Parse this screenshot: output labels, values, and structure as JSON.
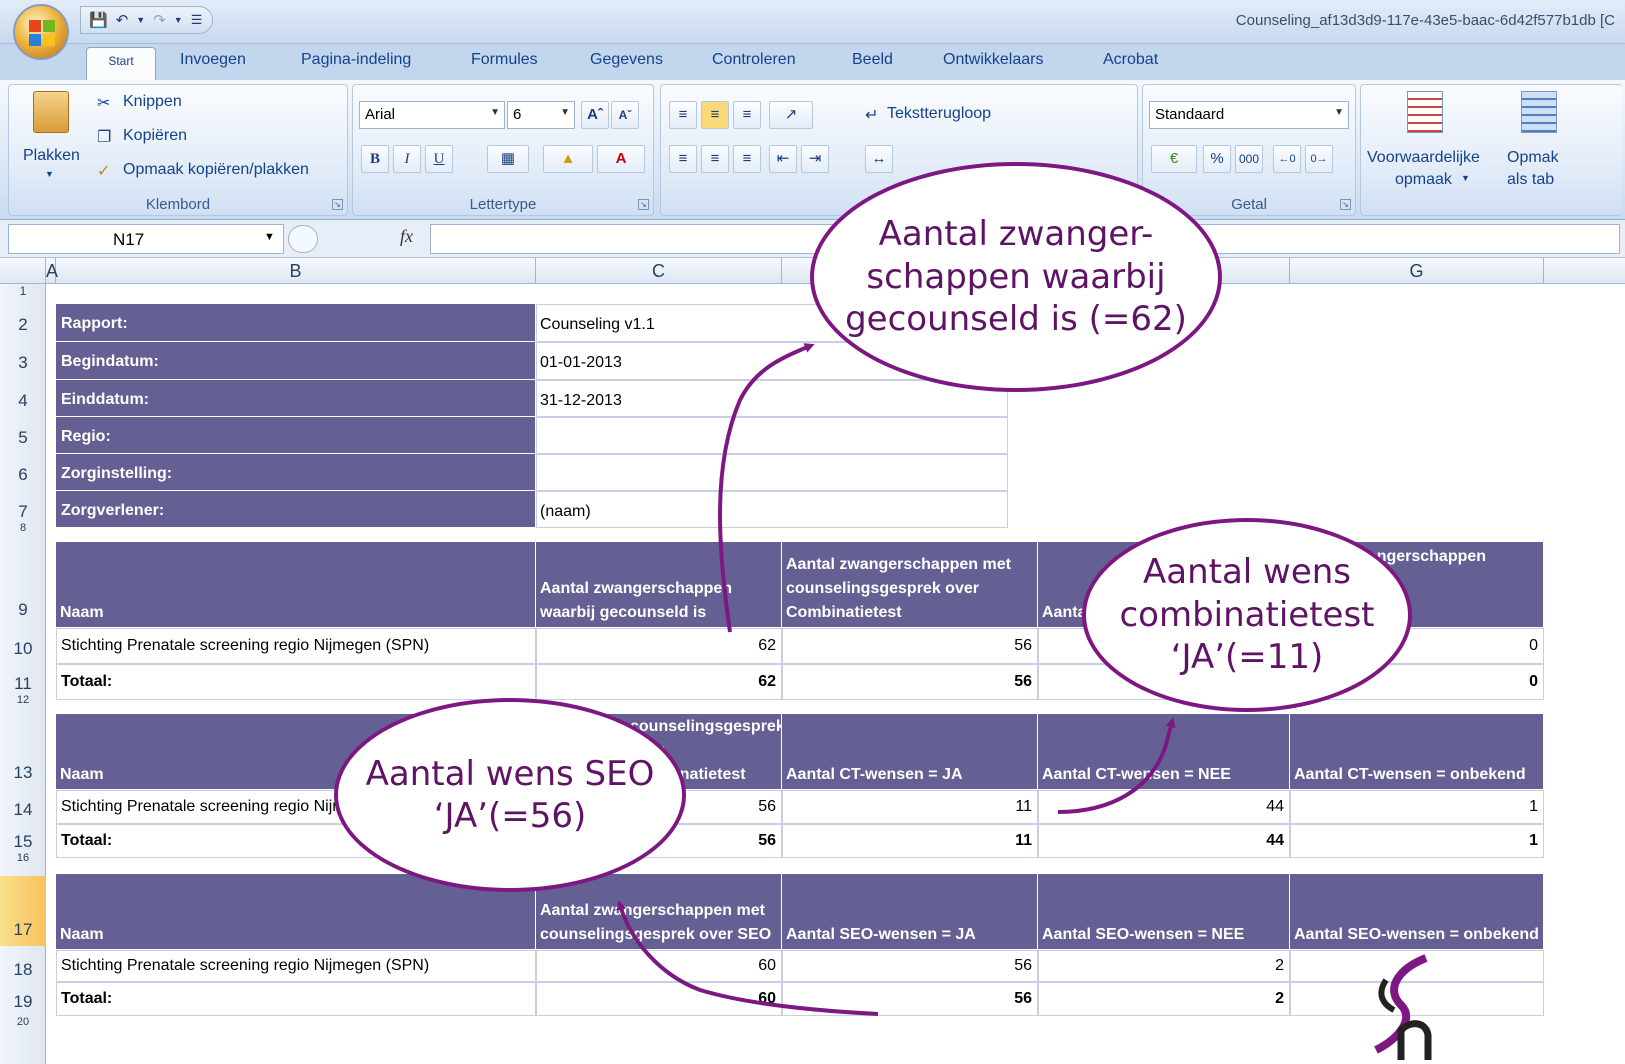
{
  "window": {
    "title": "Counseling_af13d3d9-117e-43e5-baac-6d42f577b1db  [C"
  },
  "qat": {
    "save_icon": "save-icon",
    "undo_icon": "undo-icon",
    "redo_icon": "redo-icon"
  },
  "tabs": [
    "Start",
    "Invoegen",
    "Pagina-indeling",
    "Formules",
    "Gegevens",
    "Controleren",
    "Beeld",
    "Ontwikkelaars",
    "Acrobat"
  ],
  "ribbon": {
    "clipboard": {
      "paste": "Plakken",
      "cut": "Knippen",
      "copy": "Kopiëren",
      "format_painter": "Opmaak kopiëren/plakken",
      "label": "Klembord"
    },
    "font": {
      "name": "Arial",
      "size": "6",
      "bold": "B",
      "italic": "I",
      "underline": "U",
      "label": "Lettertype"
    },
    "alignment": {
      "wrap": "Tekstterugloop"
    },
    "number": {
      "format": "Standaard",
      "percent": "%",
      "thousands": "000",
      "label": "Getal"
    },
    "styles": {
      "conditional": "Voorwaardelijke",
      "conditional2": "opmaak",
      "table": "Opmak",
      "table2": "als tab"
    }
  },
  "formula_bar": {
    "name_box": "N17",
    "fx": "fx",
    "value": ""
  },
  "columns": [
    "A",
    "B",
    "C",
    "D",
    "E",
    "F",
    "G"
  ],
  "rows": [
    "1",
    "2",
    "3",
    "4",
    "5",
    "6",
    "7",
    "8",
    "9",
    "10",
    "11",
    "12",
    "13",
    "14",
    "15",
    "16",
    "17",
    "18",
    "19",
    "20"
  ],
  "sheet": {
    "info": [
      {
        "label": "Rapport:",
        "value": "Counseling v1.1"
      },
      {
        "label": "Begindatum:",
        "value": "01-01-2013"
      },
      {
        "label": "Einddatum:",
        "value": "31-12-2013"
      },
      {
        "label": "Regio:",
        "value": ""
      },
      {
        "label": "Zorginstelling:",
        "value": ""
      },
      {
        "label": "Zorgverlener:",
        "value": "(naam)"
      }
    ],
    "table1": {
      "headers": [
        "Naam",
        "Aantal zwangerschappen waarbij gecounseld is",
        "Aantal zwangerschappen met counselingsgesprek over Combinatietest",
        "Aanta met over",
        "Aantal zwangerschappen ngsgesprek"
      ],
      "row": [
        "Stichting Prenatale screening regio Nijmegen (SPN)",
        "62",
        "56",
        "",
        "0"
      ],
      "total": [
        "Totaal:",
        "62",
        "56",
        "",
        "0"
      ]
    },
    "table2": {
      "headers": [
        "Naam",
        "zwangerschappen met counselingsgesprek over Combinatietest",
        "Aantal CT-wensen = JA",
        "Aantal CT-wensen = NEE",
        "Aantal CT-wensen = onbekend"
      ],
      "row": [
        "Stichting Prenatale screening regio Nijmegen (SPN)",
        "56",
        "11",
        "44",
        "1"
      ],
      "total": [
        "Totaal:",
        "56",
        "11",
        "44",
        "1"
      ]
    },
    "table3": {
      "headers": [
        "Naam",
        "Aantal zwangerschappen met counselingsgesprek over SEO",
        "Aantal SEO-wensen = JA",
        "Aantal SEO-wensen = NEE",
        "Aantal SEO-wensen = onbekend"
      ],
      "row": [
        "Stichting Prenatale screening regio Nijmegen (SPN)",
        "60",
        "56",
        "2",
        ""
      ],
      "total": [
        "Totaal:",
        "60",
        "56",
        "2",
        ""
      ]
    }
  },
  "callouts": {
    "c1": "Aantal zwanger-schappen waarbij gecounseld is (=62)",
    "c2": "Aantal wens combinatietest ‘JA’(=11)",
    "c3": "Aantal wens SEO ‘JA’(=56)"
  },
  "colors": {
    "header_bg": "#656094",
    "callout": "#7d1882",
    "ribbon": "#dce8f6"
  }
}
